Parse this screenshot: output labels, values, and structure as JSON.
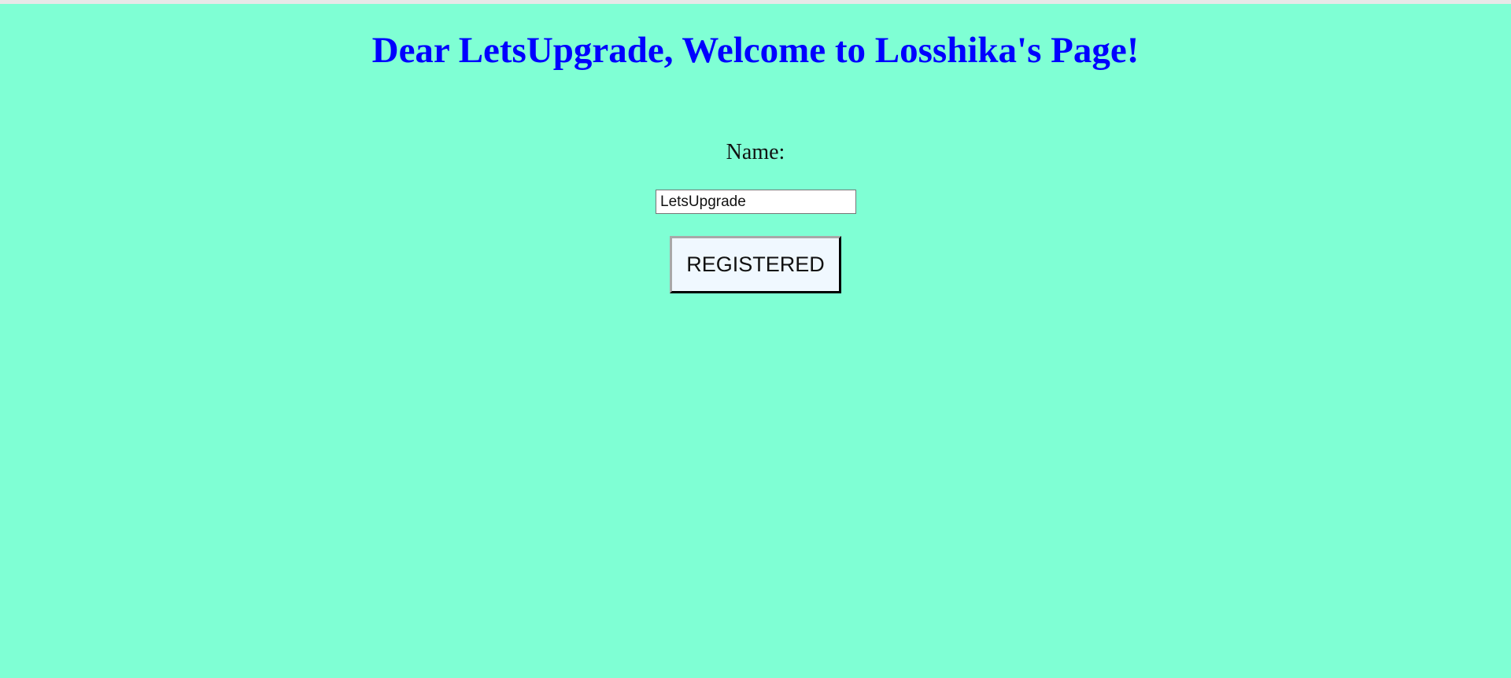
{
  "page": {
    "heading": "Dear LetsUpgrade, Welcome to Losshika's Page!",
    "background_color": "#7fffd4",
    "heading_color": "#0000ff"
  },
  "form": {
    "name_label": "Name:",
    "name_value": "LetsUpgrade",
    "submit_label": "REGISTERED"
  }
}
